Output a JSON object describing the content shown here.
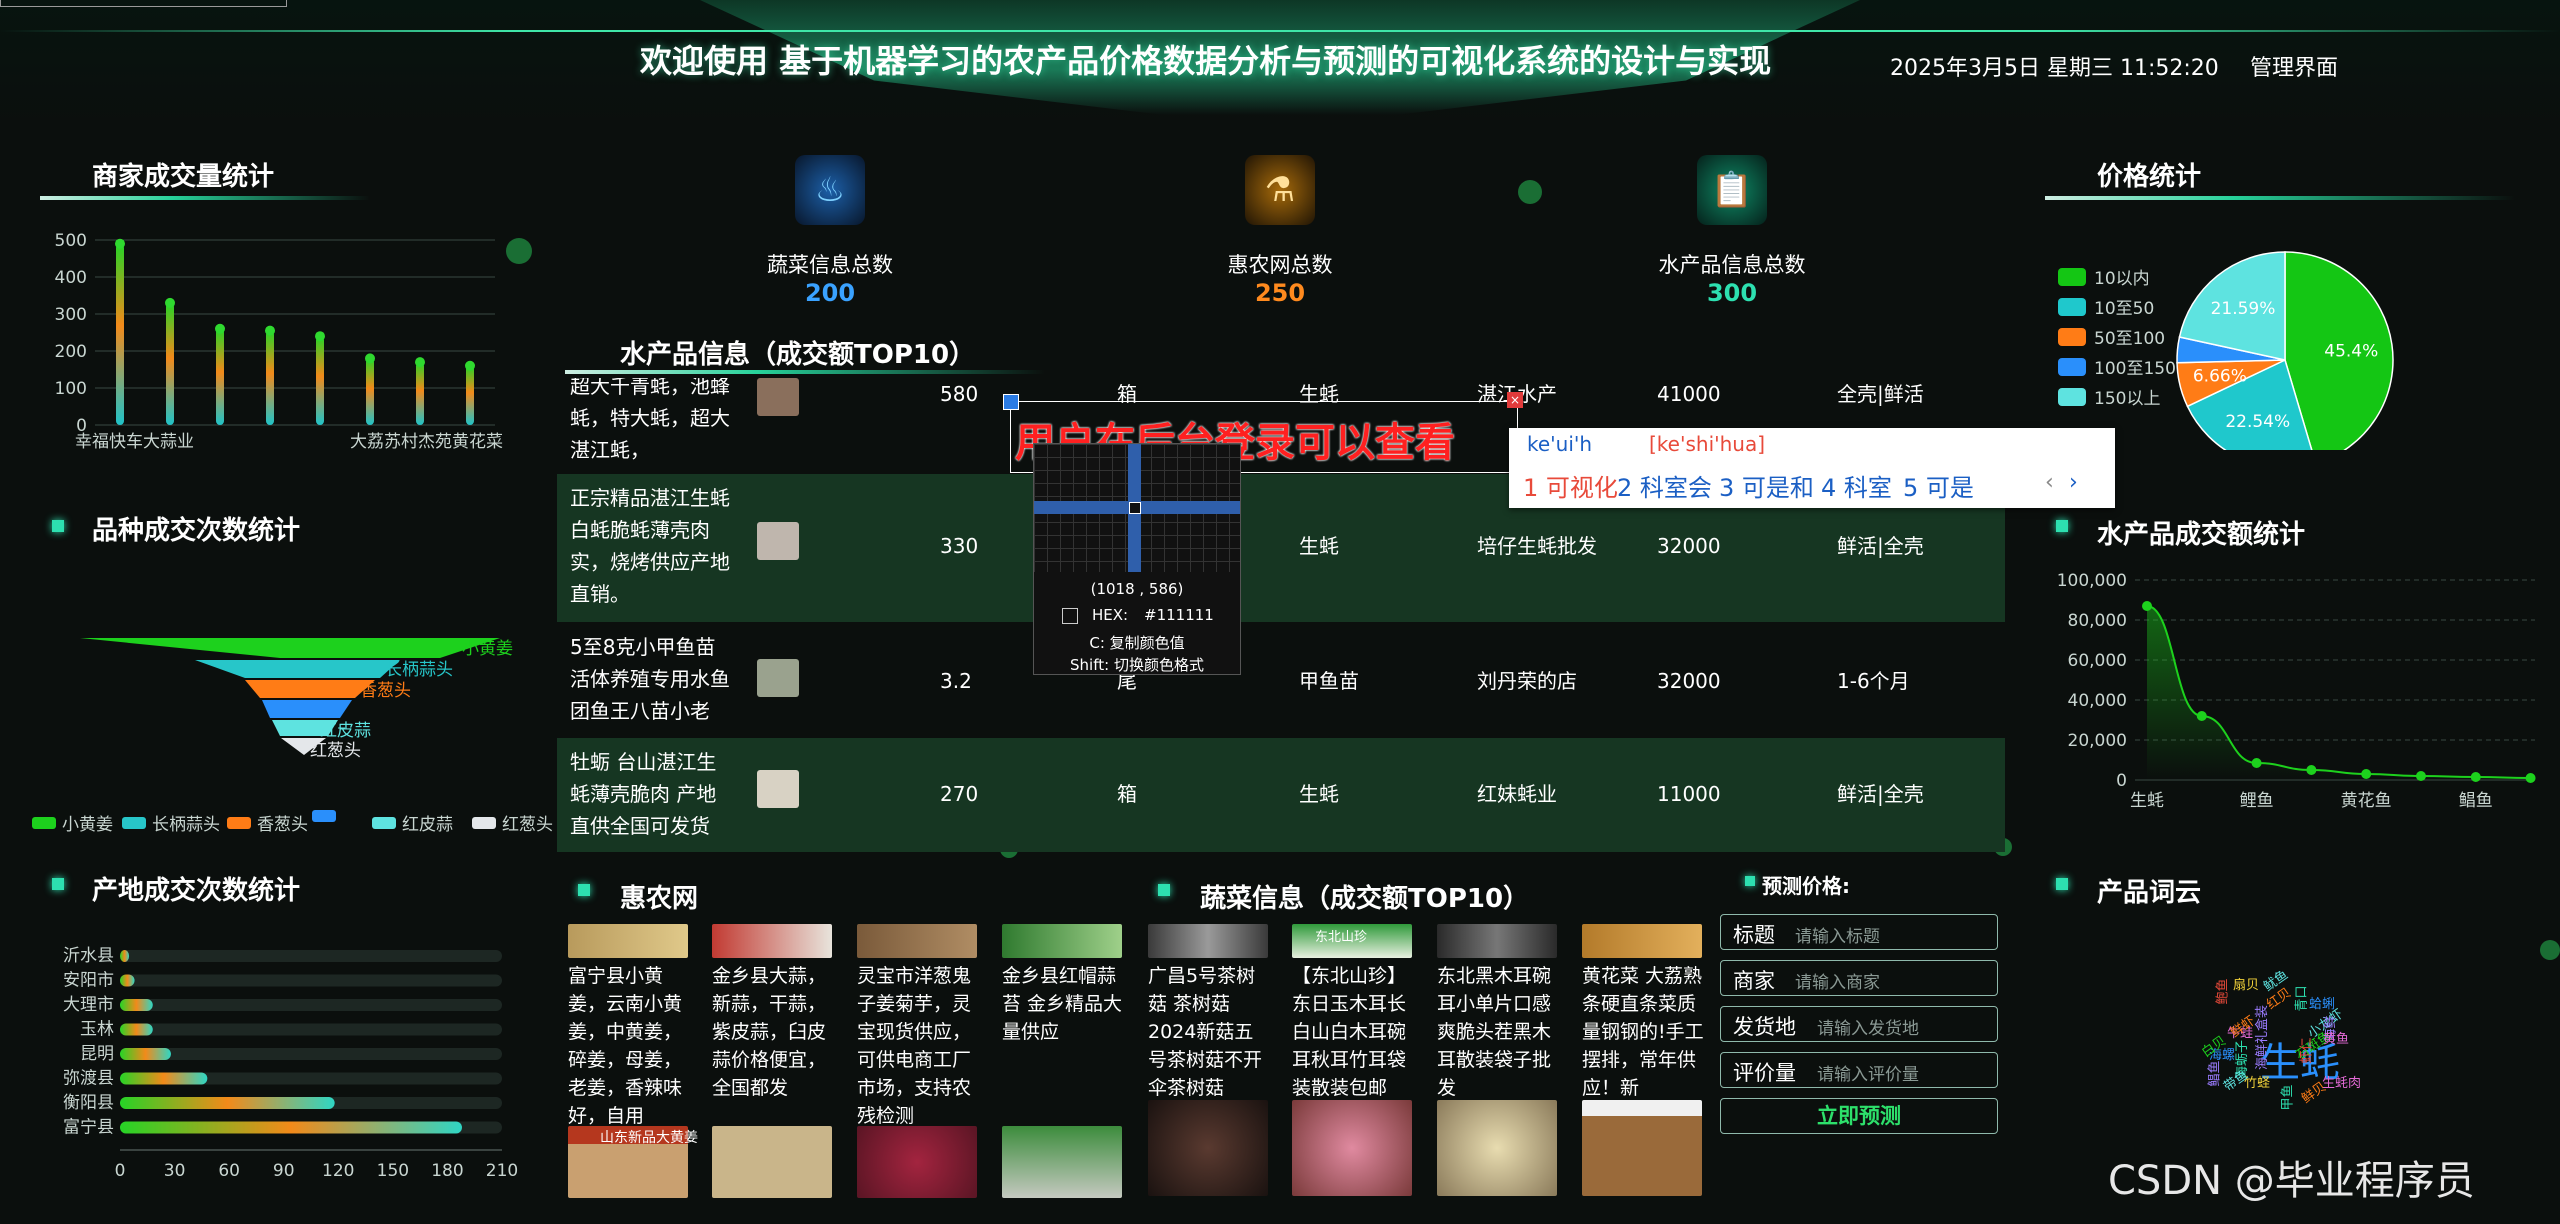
{
  "header": {
    "title": "欢迎使用 基于机器学习的农产品价格数据分析与预测的可视化系统的设计与实现",
    "datetime": "2025年3月5日 星期三 11:52:20",
    "admin_label": "管理界面"
  },
  "panels": {
    "merchant_volume": "商家成交量统计",
    "variety_count": "品种成交次数统计",
    "origin_count": "产地成交次数统计",
    "price_stats": "价格统计",
    "aquatic_amount": "水产品成交额统计",
    "word_cloud": "产品词云",
    "aquatic_top10": "水产品信息（成交额TOP10）",
    "huinong": "惠农网",
    "vegetable_top10": "蔬菜信息（成交额TOP10）",
    "predict": "预测价格:"
  },
  "stats": [
    {
      "label": "蔬菜信息总数",
      "value": "200",
      "color": "#3aa2ff",
      "icon": "thermometer-icon"
    },
    {
      "label": "惠农网总数",
      "value": "250",
      "color": "#ff8a1e",
      "icon": "flask-icon"
    },
    {
      "label": "水产品信息总数",
      "value": "300",
      "color": "#2de0b0",
      "icon": "clipboard-icon"
    }
  ],
  "merchant_chart": {
    "type": "bar",
    "categories": [
      "幸福快车大蒜业",
      "",
      "",
      "",
      "",
      "",
      "",
      "大荔苏村杰苑黄花菜"
    ],
    "values": [
      490,
      330,
      260,
      255,
      240,
      180,
      170,
      160
    ],
    "ylim": [
      0,
      500
    ],
    "yticks": [
      "0",
      "100",
      "200",
      "300",
      "400",
      "500"
    ]
  },
  "chart_data": [
    {
      "type": "bar",
      "title": "商家成交量统计",
      "categories": [
        "幸福快车大蒜业",
        "",
        "",
        "",
        "",
        "",
        "",
        "大荔苏村杰苑黄花菜"
      ],
      "values": [
        490,
        330,
        260,
        255,
        240,
        180,
        170,
        160
      ],
      "ylim": [
        0,
        500
      ]
    },
    {
      "type": "funnel",
      "title": "品种成交次数统计",
      "categories": [
        "小黄姜",
        "长柄蒜头",
        "香葱头",
        "",
        "红皮蒜",
        "红葱头"
      ],
      "values": [
        100,
        80,
        60,
        40,
        30,
        15
      ],
      "legend": [
        "小黄姜",
        "长柄蒜头",
        "香葱头",
        "",
        "红皮蒜",
        "红葱头"
      ]
    },
    {
      "type": "bar",
      "title": "产地成交次数统计",
      "categories": [
        "沂水县",
        "安阳市",
        "大理市",
        "玉林",
        "昆明",
        "弥渡县",
        "衡阳县",
        "富宁县"
      ],
      "values": [
        5,
        8,
        18,
        18,
        28,
        48,
        118,
        188
      ],
      "xlim": [
        0,
        210
      ]
    },
    {
      "type": "pie",
      "title": "价格统计",
      "categories": [
        "10以内",
        "10至50",
        "50至100",
        "100至150",
        "150以上"
      ],
      "values": [
        45.4,
        22.54,
        6.66,
        3.81,
        21.59
      ],
      "labels": [
        "45.4%",
        "22.54%",
        "6.66%",
        "",
        "21.59%"
      ]
    },
    {
      "type": "line",
      "title": "水产品成交额统计",
      "categories": [
        "生蚝",
        "",
        "鲤鱼",
        "",
        "黄花鱼",
        "",
        "鲳鱼",
        ""
      ],
      "values": [
        87000,
        32000,
        8500,
        5000,
        3000,
        2000,
        1500,
        1000
      ],
      "ylim": [
        0,
        100000
      ]
    }
  ],
  "origin_chart": {
    "categories": [
      "沂水县",
      "安阳市",
      "大理市",
      "玉林",
      "昆明",
      "弥渡县",
      "衡阳县",
      "富宁县"
    ],
    "values": [
      5,
      8,
      18,
      18,
      28,
      48,
      118,
      188
    ],
    "xticks": [
      "0",
      "30",
      "60",
      "90",
      "120",
      "150",
      "180",
      "210"
    ]
  },
  "variety_legend": [
    "小黄姜",
    "长柄蒜头",
    "香葱头",
    "",
    "红皮蒜",
    "红葱头"
  ],
  "price_legend": [
    "10以内",
    "10至50",
    "50至100",
    "100至150",
    "150以上"
  ],
  "pie_labels": [
    "45.4%",
    "22.54%",
    "6.66%",
    "21.59%"
  ],
  "aquatic_y": [
    "0",
    "20,000",
    "40,000",
    "60,000",
    "80,000",
    "100,000"
  ],
  "aquatic_x": [
    "生蚝",
    "鲤鱼",
    "黄花鱼",
    "鲳鱼"
  ],
  "table": {
    "rows": [
      {
        "name": "超大千青蚝，池蜂蚝，特大蚝，超大湛江蚝，",
        "price": "580",
        "unit": "箱",
        "type": "生蚝",
        "shop": "湛江水产",
        "amount": "41000",
        "tag": "全壳|鲜活"
      },
      {
        "name": "正宗精品湛江生蚝白蚝脆蚝薄壳肉实，烧烤供应产地直销。",
        "price": "330",
        "unit": "",
        "type": "生蚝",
        "shop": "培仔生蚝批发",
        "amount": "32000",
        "tag": "鲜活|全壳"
      },
      {
        "name": "5至8克小甲鱼苗活体养殖专用水鱼团鱼王八苗小老",
        "price": "3.2",
        "unit": "尾",
        "type": "甲鱼苗",
        "shop": "刘丹荣的店",
        "amount": "32000",
        "tag": "1-6个月"
      },
      {
        "name": "牡蛎 台山湛江生蚝薄壳脆肉 产地直供全国可发货",
        "price": "270",
        "unit": "箱",
        "type": "生蚝",
        "shop": "红妹蚝业",
        "amount": "11000",
        "tag": "鲜活|全壳"
      }
    ]
  },
  "overlay_red": "用户在后台登录可以查看",
  "color_picker": {
    "coord": "(1018 , 586)",
    "hex_label": "HEX:",
    "hex": "#111111",
    "copy": "C: 复制颜色值",
    "shift": "Shift: 切换颜色格式"
  },
  "ime": {
    "input": "ke'ui'h",
    "pinyin": "[ke'shi'hua]",
    "candidates": [
      "可视化",
      "科室会",
      "可是和",
      "科室",
      "可是"
    ]
  },
  "huinong_items": [
    "富宁县小黄姜，云南小黄姜，中黄姜，碎姜，母姜，老姜，香辣味好，自用",
    "金乡县大蒜，新蒜，干蒜，紫皮蒜，臼皮蒜价格便宜，全国都发",
    "灵宝市洋葱鬼子姜菊芋，灵宝现货供应，可供电商工厂市场，支持农残检测",
    "金乡县红帽蒜苔 金乡精品大量供应"
  ],
  "huinong_banner": "山东新品大黄姜",
  "vegetable_items": [
    "广昌5号茶树菇 茶树菇2024新菇五号茶树菇不开伞茶树菇",
    "【东北山珍】东日玉木耳长白山白木耳碗耳秋耳竹耳袋装散装包邮",
    "东北黑木耳碗耳小单片口感爽脆头茬黑木耳散装袋子批发",
    "黄花菜 大荔熟条硬直条菜质量钢钢的!手工摆排，常年供应！新"
  ],
  "vegetable_banner": "东北山珍",
  "form": {
    "fields": [
      {
        "label": "标题",
        "placeholder": "请输入标题"
      },
      {
        "label": "商家",
        "placeholder": "请输入商家"
      },
      {
        "label": "发货地",
        "placeholder": "请输入发货地"
      },
      {
        "label": "评价量",
        "placeholder": "请输入评价量"
      }
    ],
    "submit": "立即预测"
  },
  "word_cloud": [
    "生蚝",
    "海蛎子",
    "红贝",
    "生蚝肉",
    "海鲜礼盒装",
    "小龙虾",
    "竹蛏",
    "鲍鱼",
    "石斑鱼",
    "海螺",
    "青口",
    "鲜贝",
    "牛蛙",
    "海鲜",
    "带鱼",
    "扇贝",
    "虾仁",
    "白贝",
    "蛤蜊",
    "甲鱼",
    "鲜虾",
    "黄鱼",
    "鲳鱼",
    "鱿鱼"
  ],
  "watermark": "CSDN @毕业程序员"
}
